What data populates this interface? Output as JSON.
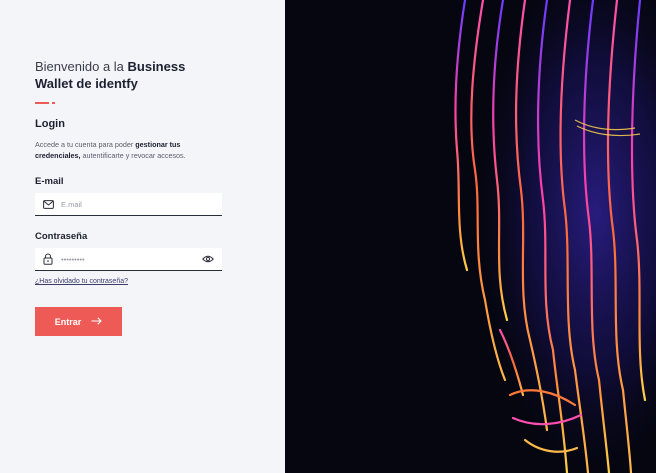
{
  "welcome": {
    "prefix": "Bienvenido a la ",
    "brand_part1": "Business",
    "brand_part2": "Wallet de identfy"
  },
  "login": {
    "title": "Login",
    "desc_prefix": "Accede a tu cuenta para poder ",
    "desc_bold": "gestionar tus credenciales,",
    "desc_suffix": " autentificarte y revocar accesos."
  },
  "email": {
    "label": "E-mail",
    "placeholder": "E.mail",
    "icon": "mail-icon"
  },
  "password": {
    "label": "Contraseña",
    "masked_value": "•••••••••",
    "icon": "lock-icon",
    "toggle_icon": "eye-icon"
  },
  "forgot_link": "¿Has olvidado tu contraseña?",
  "submit": {
    "label": "Entrar",
    "icon": "arrow-right-icon"
  },
  "colors": {
    "accent": "#ee5a56",
    "background": "#f4f5f9",
    "dark": "#05060f"
  }
}
